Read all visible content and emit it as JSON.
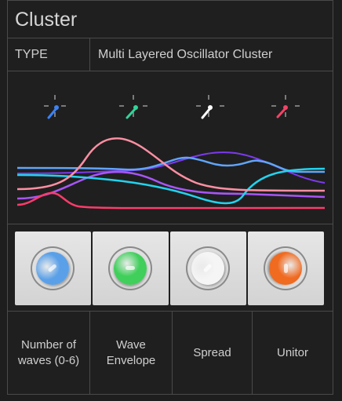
{
  "title": "Cluster",
  "type_label": "TYPE",
  "type_value": "Multi Layered Oscillator Cluster",
  "wave_colors": [
    "#3b82f6",
    "#34d399",
    "#ffffff",
    "#ef4566"
  ],
  "curve_colors": [
    "#ff3b6b",
    "#ff8fa3",
    "#a855f7",
    "#22d3ee",
    "#60a5fa",
    "#7c3aed"
  ],
  "knobs": [
    {
      "color": "#5aa0e8",
      "name": "number-of-waves"
    },
    {
      "color": "#3fcf5a",
      "name": "wave-envelope"
    },
    {
      "color": "#f5f5f5",
      "name": "spread"
    },
    {
      "color": "#f06a1f",
      "name": "unitor"
    }
  ],
  "labels": {
    "number_of_waves": "Number of waves (0-6)",
    "wave_envelope": "Wave Envelope",
    "spread": "Spread",
    "unitor": "Unitor"
  }
}
